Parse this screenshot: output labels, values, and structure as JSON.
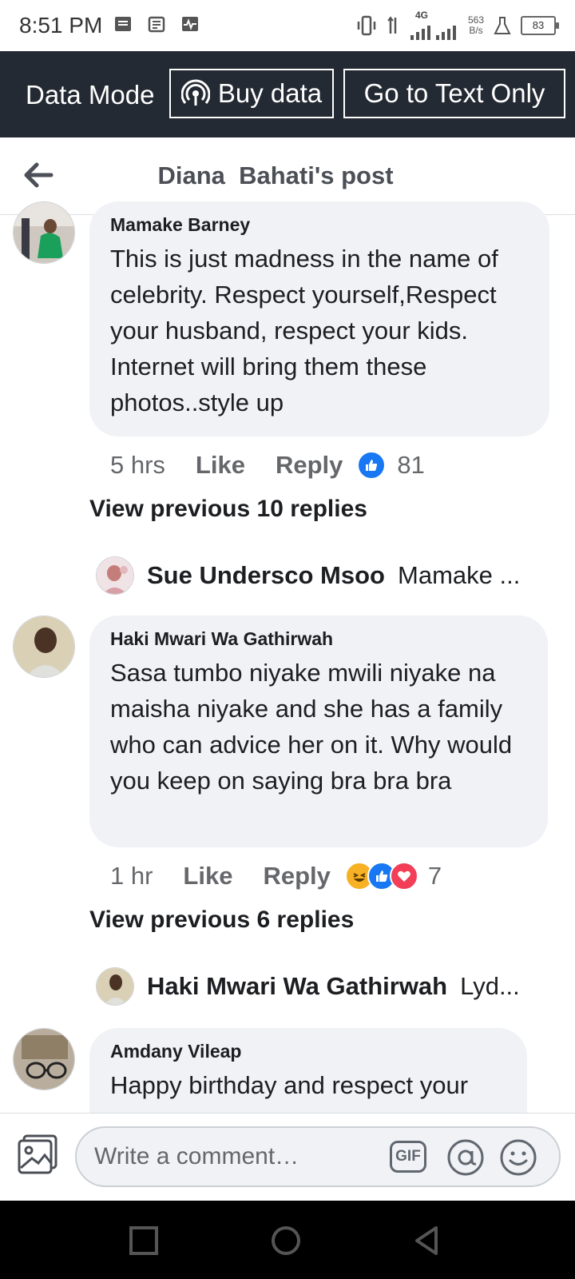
{
  "status_bar": {
    "time": "8:51 PM",
    "net_type": "4G",
    "speed_value": "563",
    "speed_unit": "B/s",
    "battery": "83"
  },
  "banner": {
    "mode_label": "Data Mode",
    "buy_label": "Buy data",
    "text_only_label": "Go to Text Only"
  },
  "header": {
    "title": "Diana  Bahati's post"
  },
  "comments": [
    {
      "author": "Mamake Barney",
      "text": "This is just madness in the name of celebrity. Respect yourself,Respect your husband, respect your kids. Internet will bring them these photos..style up",
      "time": "5 hrs",
      "like_label": "Like",
      "reply_label": "Reply",
      "reaction_count": "81",
      "view_previous": "View previous 10 replies",
      "latest_reply": {
        "author": "Sue Undersco Msoo",
        "text": "Mamake ..."
      }
    },
    {
      "author": "Haki Mwari Wa Gathirwah",
      "text": "Sasa tumbo niyake mwili niyake na maisha niyake and she has a family who can advice her on it. Why would you  keep on saying bra bra bra",
      "time": "1 hr",
      "like_label": "Like",
      "reply_label": "Reply",
      "reaction_count": "7",
      "view_previous": "View previous 6 replies",
      "latest_reply": {
        "author": "Haki Mwari Wa Gathirwah",
        "text": "Lyd..."
      }
    },
    {
      "author": "Amdany Vileap",
      "text": "Happy birthday  and respect your"
    }
  ],
  "composer": {
    "placeholder": "Write a comment…",
    "gif_label": "GIF"
  },
  "colors": {
    "banner_bg": "#242a33",
    "like_blue": "#1877f2",
    "love_red": "#f33e58",
    "haha_yellow": "#f7b125",
    "bubble_bg": "#f0f2f5"
  }
}
